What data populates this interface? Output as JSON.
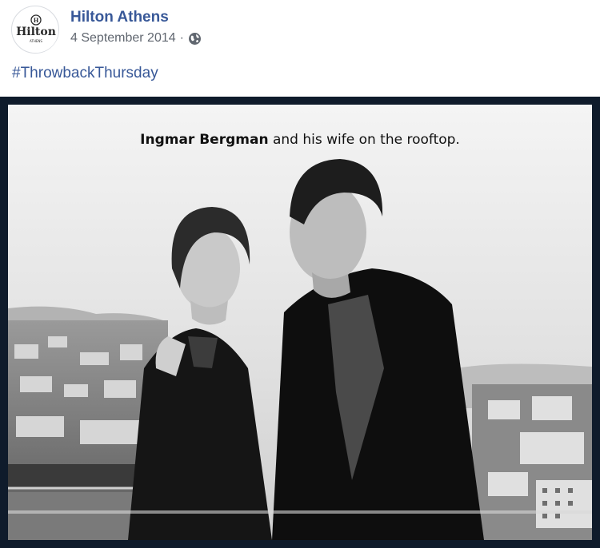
{
  "post": {
    "page_name": "Hilton Athens",
    "date": "4 September 2014",
    "separator": "·",
    "privacy_icon": "globe-icon",
    "caption": "#ThrowbackThursday"
  },
  "avatar": {
    "logo_text": "Hilton",
    "logo_subtext": "ATHENS",
    "logo_mark": "(H)"
  },
  "photo": {
    "caption_bold": "Ingmar Bergman",
    "caption_rest": " and his wife on the rooftop."
  },
  "colors": {
    "link": "#385898",
    "meta": "#616770",
    "frame": "#0f1b2b"
  }
}
